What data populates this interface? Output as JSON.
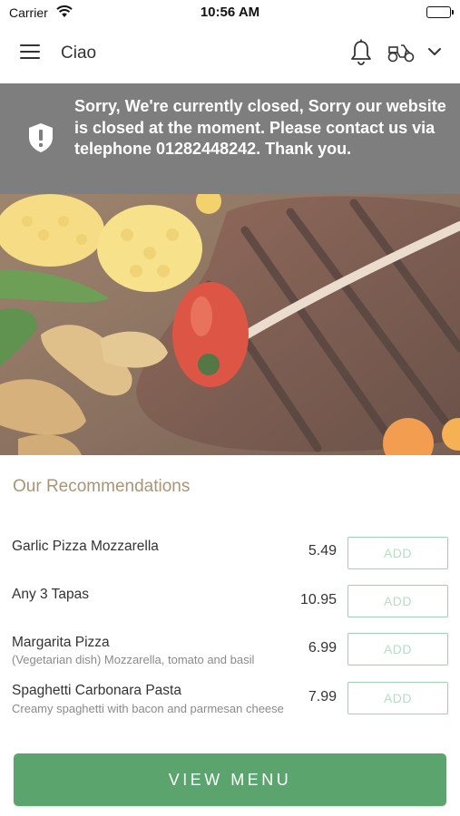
{
  "status_bar": {
    "carrier": "Carrier",
    "time": "10:56 AM"
  },
  "header": {
    "title": "Ciao",
    "icons": [
      "menu-icon",
      "bell-icon",
      "scooter-icon",
      "chevron-down-icon"
    ]
  },
  "banner": {
    "icon": "shield-alert-icon",
    "message": "Sorry, We're currently closed, Sorry our website is closed at the moment. Please contact us via telephone 01282448242. Thank you.",
    "color": "#7e7e7e"
  },
  "recommendations": {
    "title": "Our Recommendations",
    "items": [
      {
        "name": "Garlic Pizza Mozzarella",
        "description": "",
        "price": "5.49",
        "button": "ADD"
      },
      {
        "name": "Any 3 Tapas",
        "description": "",
        "price": "10.95",
        "button": "ADD"
      },
      {
        "name": "Margarita Pizza",
        "description": "(Vegetarian dish) Mozzarella, tomato and basil",
        "price": "6.99",
        "button": "ADD"
      },
      {
        "name": "Spaghetti Carbonara Pasta",
        "description": "Creamy spaghetti with bacon and parmesan cheese",
        "price": "7.99",
        "button": "ADD"
      }
    ]
  },
  "footer": {
    "view_menu_label": "VIEW MENU",
    "accent_color": "#5ba46d"
  }
}
